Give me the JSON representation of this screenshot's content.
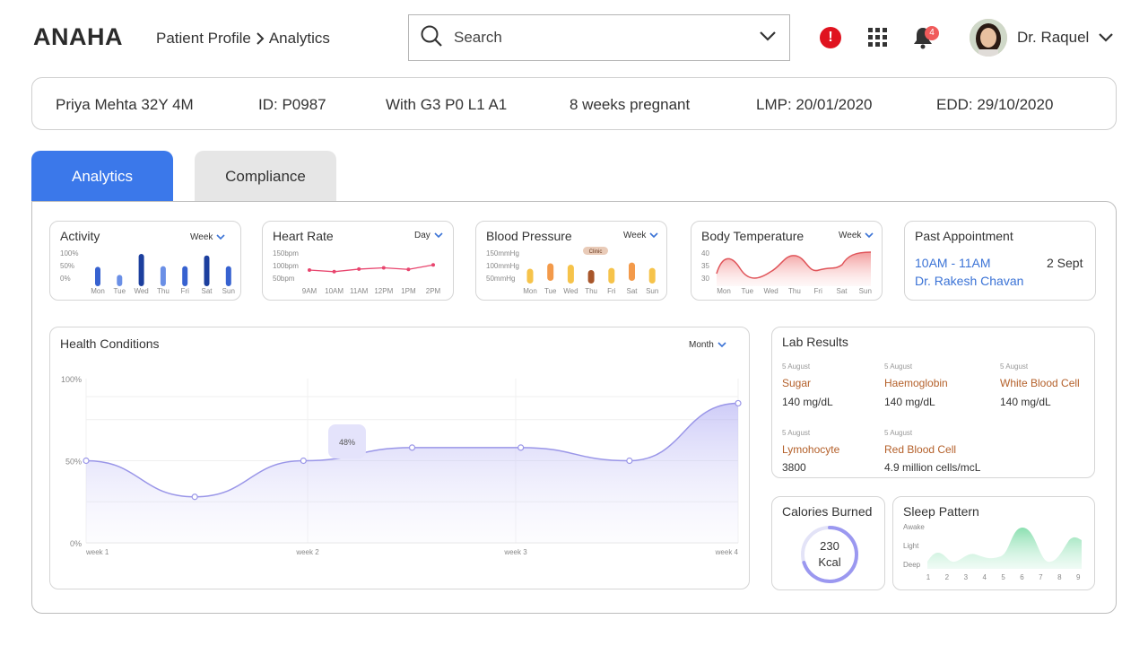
{
  "header": {
    "logo": "ANAHA",
    "breadcrumb": {
      "parent": "Patient Profile",
      "current": "Analytics"
    },
    "search_placeholder": "Search",
    "alert_symbol": "!",
    "notification_count": "4",
    "user_name": "Dr. Raquel"
  },
  "patient": {
    "name": "Priya Mehta 32Y 4M",
    "id": "ID: P0987",
    "with_label": "With",
    "g": "G",
    "g_val": "3",
    "p": "P",
    "p_val": "0",
    "l": "L",
    "l_val": "1",
    "a": "A",
    "a_val": "1",
    "pregnancy": "8 weeks pregnant",
    "lmp": "LMP: 20/01/2020",
    "edd": "EDD: 29/10/2020"
  },
  "tabs": {
    "analytics": "Analytics",
    "compliance": "Compliance"
  },
  "cards": {
    "activity": {
      "title": "Activity",
      "period": "Week",
      "y_ticks": [
        "100%",
        "50%",
        "0%"
      ],
      "days": [
        "Mon",
        "Tue",
        "Wed",
        "Thu",
        "Fri",
        "Sat",
        "Sun"
      ],
      "values": [
        0.6,
        0.35,
        1.0,
        0.62,
        0.62,
        0.95,
        0.62
      ]
    },
    "heart_rate": {
      "title": "Heart Rate",
      "period": "Day",
      "y_ticks": [
        "150bpm",
        "100bpm",
        "50bpm"
      ],
      "times": [
        "9AM",
        "10AM",
        "11AM",
        "12PM",
        "1PM",
        "2PM"
      ],
      "values": [
        100,
        95,
        103,
        107,
        102,
        116
      ]
    },
    "blood_pressure": {
      "title": "Blood Pressure",
      "period": "Week",
      "y_ticks": [
        "150mmHg",
        "100mmHg",
        "50mmHg"
      ],
      "days": [
        "Mon",
        "Tue",
        "Wed",
        "Thu",
        "Fri",
        "Sat",
        "Sun"
      ],
      "clinic_label": "Clinic",
      "ranges": [
        [
          60,
          115
        ],
        [
          70,
          135
        ],
        [
          60,
          130
        ],
        [
          60,
          110
        ],
        [
          60,
          118
        ],
        [
          70,
          138
        ],
        [
          60,
          118
        ]
      ],
      "colors": [
        "#f6c34a",
        "#f39a4a",
        "#f6c34a",
        "#a8562a",
        "#f6c34a",
        "#f39a4a",
        "#f6c34a"
      ]
    },
    "body_temp": {
      "title": "Body Temperature",
      "period": "Week",
      "y_ticks": [
        "40",
        "35",
        "30"
      ],
      "days": [
        "Mon",
        "Tue",
        "Wed",
        "Thu",
        "Fri",
        "Sat",
        "Sun"
      ]
    },
    "past_appointment": {
      "title": "Past Appointment",
      "time": "10AM - 11AM",
      "date": "2 Sept",
      "doctor": "Dr. Rakesh Chavan"
    },
    "health_conditions": {
      "title": "Health Conditions",
      "period": "Month",
      "tooltip": "48%",
      "weeks": [
        "week 1",
        "week 2",
        "week 3",
        "week 4"
      ]
    },
    "lab_results": {
      "title": "Lab Results",
      "items": [
        {
          "date": "5 August",
          "name": "Sugar",
          "value": "140 mg/dL"
        },
        {
          "date": "5 August",
          "name": "Haemoglobin",
          "value": "140 mg/dL"
        },
        {
          "date": "5 August",
          "name": "White Blood Cell",
          "value": "140 mg/dL"
        },
        {
          "date": "5 August",
          "name": "Lymohocyte",
          "value": "3800"
        },
        {
          "date": "5 August",
          "name": "Red Blood Cell",
          "value": "4.9 million cells/mcL"
        }
      ]
    },
    "calories": {
      "title": "Calories Burned",
      "value": "230",
      "unit": "Kcal",
      "progress": 0.7
    },
    "sleep": {
      "title": "Sleep Pattern",
      "levels": [
        "Awake",
        "Light",
        "Deep"
      ],
      "hours": [
        "1",
        "2",
        "3",
        "4",
        "5",
        "6",
        "7",
        "8",
        "9"
      ]
    }
  },
  "chart_data": [
    {
      "type": "line",
      "title": "Health Conditions",
      "x": [
        "week 1",
        "",
        "week 2",
        "",
        "week 3",
        "",
        "week 4"
      ],
      "series": [
        {
          "values": [
            50,
            28,
            50,
            58,
            58,
            50,
            85
          ]
        }
      ],
      "y_ticks": [
        "100%",
        "50%",
        "0%"
      ],
      "ylim": [
        0,
        100
      ],
      "annotation": "48%"
    }
  ]
}
